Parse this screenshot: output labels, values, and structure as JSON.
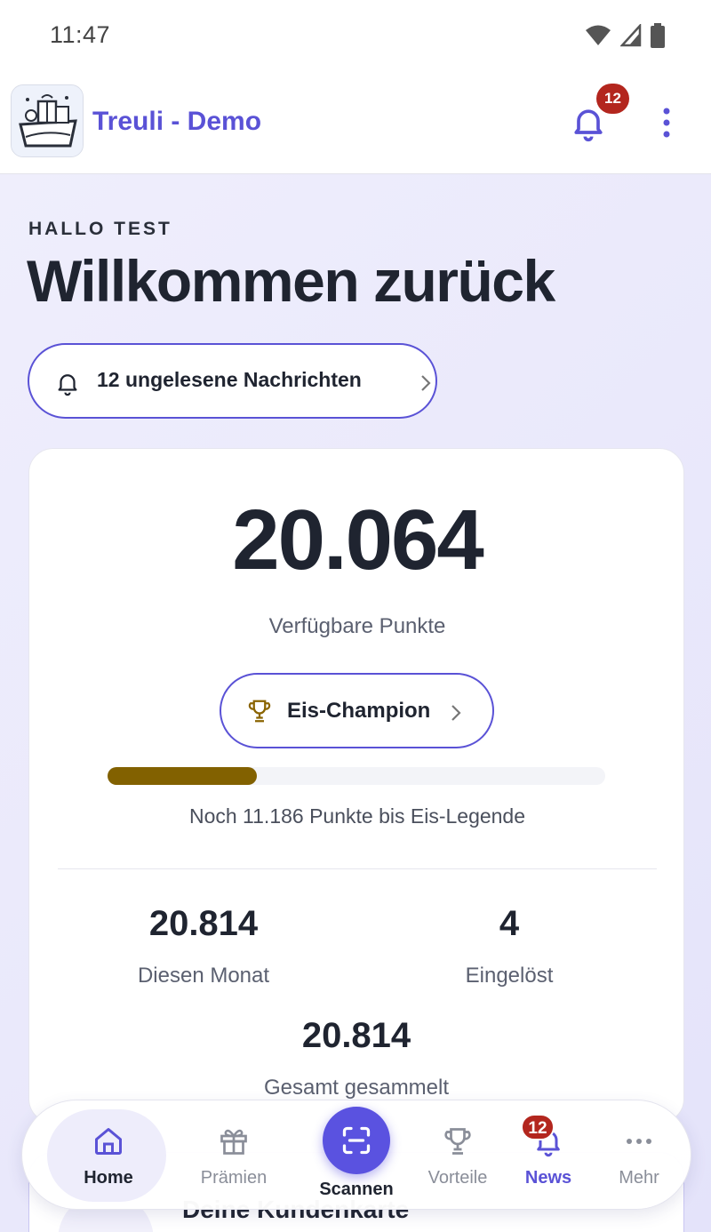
{
  "status_bar": {
    "time": "11:47"
  },
  "app_bar": {
    "title": "Treuli - Demo",
    "notification_count": "12"
  },
  "greeting": {
    "kicker": "HALLO TEST",
    "title": "Willkommen zurück"
  },
  "messages_pill": {
    "label": "12 ungelesene Nachrichten"
  },
  "points_card": {
    "points": "20.064",
    "points_label": "Verfügbare Punkte",
    "tier_label": "Eis-Champion",
    "progress": 0.3,
    "progress_text": "Noch 11.186 Punkte bis Eis-Legende",
    "stats": {
      "month_value": "20.814",
      "month_label": "Diesen Monat",
      "redeemed_value": "4",
      "redeemed_label": "Eingelöst",
      "total_value": "20.814",
      "total_label": "Gesamt gesammelt"
    }
  },
  "next_card": {
    "title": "Deine Kundenkarte"
  },
  "bottom_nav": {
    "home": "Home",
    "rewards": "Prämien",
    "scan": "Scannen",
    "benefits": "Vorteile",
    "news": "News",
    "news_badge": "12",
    "more": "Mehr"
  },
  "colors": {
    "accent": "#5a52d6",
    "badge": "#b3261e",
    "progress": "#826100",
    "tier_icon": "#8a6400"
  }
}
